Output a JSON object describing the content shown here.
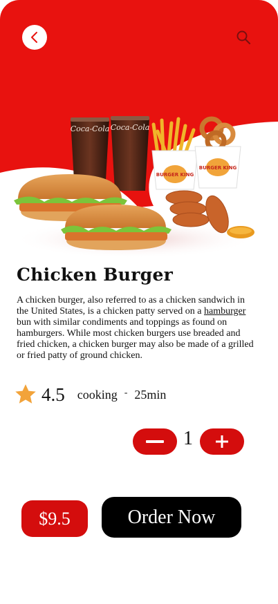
{
  "colors": {
    "brand_red": "#e8120f",
    "button_red": "#d40d0d",
    "order_black": "#000000",
    "star_orange": "#f2a33a"
  },
  "header": {
    "back_icon": "chevron-left-icon",
    "search_icon": "search-icon"
  },
  "product": {
    "image_name": "chicken-burger-meal-image",
    "image_texts": {
      "cup1": "Coca-Cola",
      "cup2": "Coca-Cola",
      "fries_box": "BURGER KING",
      "rings_box": "BURGER KING"
    },
    "title": "Chicken Burger",
    "description_part1": "A chicken burger, also referred to as a chicken sandwich in the United States, is a chicken patty served on a ",
    "description_link": "hamburger",
    "description_part2": " bun with similar condiments and toppings as found on hamburgers. While most chicken burgers use breaded and fried chicken, a chicken burger may also be made of a grilled or fried patty of ground chicken.",
    "rating": "4.5",
    "cooking_label": "cooking",
    "separator": "-",
    "cooking_time": "25min"
  },
  "quantity": {
    "value": "1"
  },
  "footer": {
    "price": "$9.5",
    "order_label": "Order Now"
  }
}
